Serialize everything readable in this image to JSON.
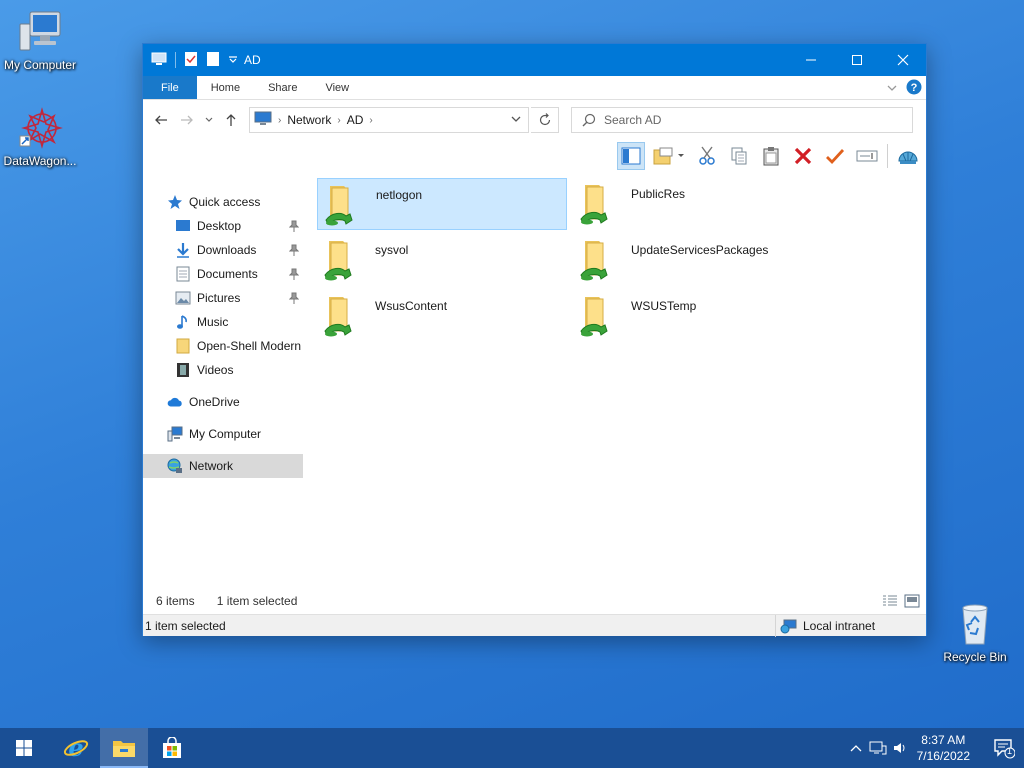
{
  "desktop": {
    "icons": [
      {
        "label": "My Computer"
      },
      {
        "label": "DataWagon..."
      },
      {
        "label": "Recycle Bin"
      }
    ]
  },
  "window": {
    "title": "AD",
    "ribbon_tabs": [
      "File",
      "Home",
      "Share",
      "View"
    ],
    "address": {
      "crumbs": [
        "Network",
        "AD"
      ]
    },
    "search": {
      "placeholder": "Search AD"
    },
    "nav": {
      "quick_access": "Quick access",
      "items": [
        "Desktop",
        "Downloads",
        "Documents",
        "Pictures",
        "Music",
        "Open-Shell Modern",
        "Videos"
      ],
      "onedrive": "OneDrive",
      "my_computer": "My Computer",
      "network": "Network"
    },
    "files": [
      {
        "name": "netlogon",
        "selected": true
      },
      {
        "name": "PublicRes"
      },
      {
        "name": "sysvol"
      },
      {
        "name": "UpdateServicesPackages"
      },
      {
        "name": "WsusContent"
      },
      {
        "name": "WSUSTemp"
      }
    ],
    "status": {
      "count": "6 items",
      "selected": "1 item selected",
      "bottom_selected": "1 item selected",
      "zone": "Local intranet"
    }
  },
  "taskbar": {
    "time": "8:37 AM",
    "date": "7/16/2022",
    "notification_count": "1"
  },
  "colors": {
    "accent": "#0078d7",
    "selection": "#cce8ff",
    "taskbar": "#1a4f95"
  }
}
